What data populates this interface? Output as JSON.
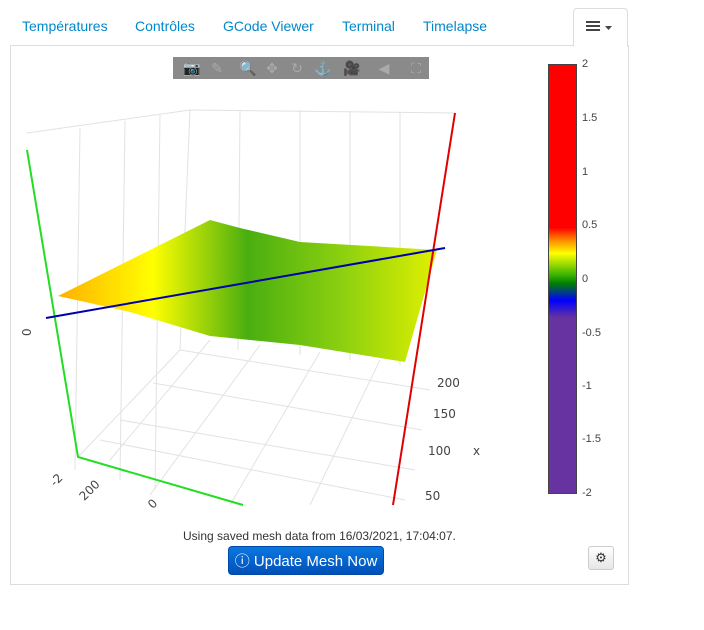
{
  "tabs": [
    {
      "label": "Températures"
    },
    {
      "label": "Contrôles"
    },
    {
      "label": "GCode Viewer"
    },
    {
      "label": "Terminal"
    },
    {
      "label": "Timelapse"
    }
  ],
  "tab_menu": {
    "icon": "hamburger-icon",
    "caret": "▾"
  },
  "modebar": [
    "camera-icon",
    "pencil-icon",
    "zoom-icon",
    "pan-icon",
    "orbit-icon",
    "turntable-icon",
    "reset-camera-icon",
    "hover-icon",
    "fullscreen-icon"
  ],
  "plot": {
    "x_axis_label": "x",
    "x_ticks": [
      "200",
      "150",
      "100",
      "50"
    ],
    "z_tick": "-2",
    "y_ticks": [
      "200",
      "0"
    ],
    "left_partial_tick": "0",
    "axis_colors": {
      "x": "#e00000",
      "y": "#22dd22",
      "z": "#0000aa"
    },
    "colorscale": [
      "#6633a0",
      "#0000ff",
      "#008000",
      "#ffff00",
      "#ff8c00",
      "#ff0000"
    ]
  },
  "colorbar": {
    "ticks": [
      "2",
      "1.5",
      "1",
      "0.5",
      "0",
      "-0.5",
      "-1",
      "-1.5",
      "-2"
    ],
    "range": [
      -2,
      2
    ]
  },
  "status": "Using saved mesh data from 16/03/2021, 17:04:07.",
  "update_button": {
    "icon": "info-icon",
    "label": "Update Mesh Now"
  },
  "settings_button": {
    "icon": "gear-icon"
  }
}
